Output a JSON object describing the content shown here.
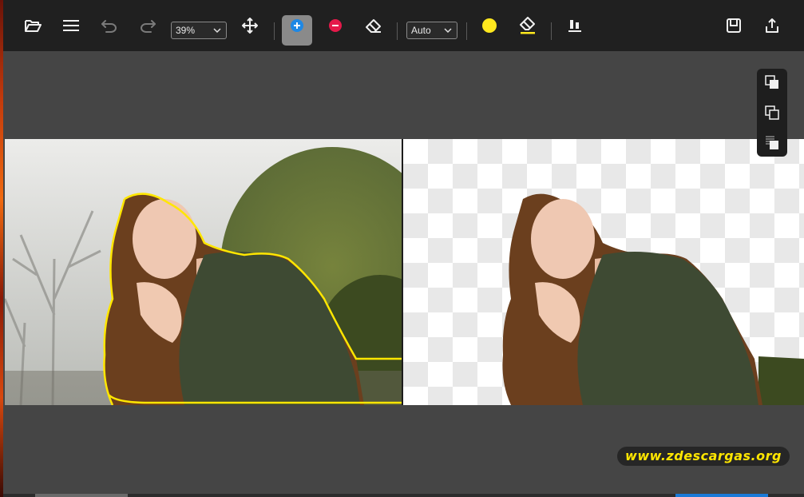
{
  "toolbar": {
    "open_icon": "folder-open-icon",
    "menu_icon": "hamburger-menu-icon",
    "undo_icon": "undo-icon",
    "redo_icon": "redo-icon",
    "zoom_value": "39%",
    "move_icon": "move-arrows-icon",
    "keep_icon": "plus-circle-icon",
    "remove_icon": "minus-circle-icon",
    "erase_icon": "eraser-icon",
    "mode_value": "Auto",
    "color_icon": "color-dot-icon",
    "color_value": "#FFE81E",
    "clear_icon": "eraser-underline-icon",
    "align_icon": "align-bottom-icon",
    "save_icon": "save-icon",
    "export_icon": "share-export-icon"
  },
  "side_panel": {
    "items": [
      {
        "icon": "copy-layer-icon"
      },
      {
        "icon": "duplicate-layer-icon"
      },
      {
        "icon": "transparent-layer-icon"
      }
    ]
  },
  "colors": {
    "toolbar_bg": "#202020",
    "canvas_bg": "#454545",
    "active_tool_bg": "#8A8A8A",
    "keep_blue": "#1E88E5",
    "remove_red": "#E5194A",
    "outline_yellow": "#FFE600"
  },
  "watermark": {
    "text": "www.zdescargas.org"
  }
}
